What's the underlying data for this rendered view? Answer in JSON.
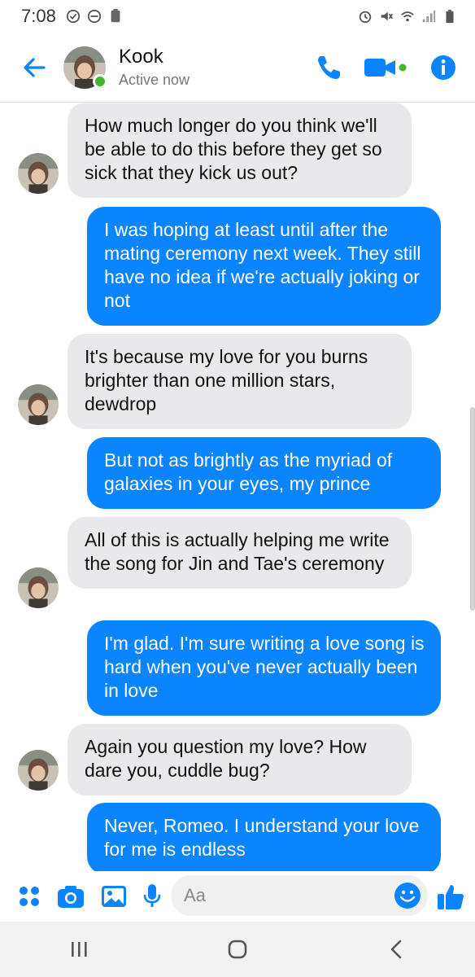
{
  "status_bar": {
    "time": "7:08",
    "left_icons": [
      "shield-check-icon",
      "do-not-disturb-icon",
      "battery-saver-icon"
    ],
    "right_icons": [
      "alarm-icon",
      "mute-icon",
      "wifi-icon",
      "signal-icon",
      "battery-icon"
    ]
  },
  "header": {
    "contact_name": "Kook",
    "contact_status": "Active now",
    "colors": {
      "accent": "#0b84ff",
      "active": "#42b72a"
    }
  },
  "messages": [
    {
      "direction": "in",
      "text": "How much longer do you think we'll be able to do this before they get so sick that they kick us out?"
    },
    {
      "direction": "out",
      "text": "I was hoping at least until after the mating ceremony next week. They still have no idea if we're actually joking or not"
    },
    {
      "direction": "in",
      "text": "It's because my love for you burns brighter than one million stars, dewdrop"
    },
    {
      "direction": "out",
      "text": "But not as brightly as the myriad of galaxies in your eyes, my prince"
    },
    {
      "direction": "in",
      "text": "All of this is actually helping me write the song for Jin and Tae's ceremony"
    },
    {
      "direction": "out",
      "text": "I'm glad. I'm sure writing a love song is hard when you've never actually been in love"
    },
    {
      "direction": "in",
      "text": "Again you question my love? How dare you, cuddle bug?"
    },
    {
      "direction": "out",
      "text": "Never, Romeo. I understand your love for me is endless"
    }
  ],
  "composer": {
    "placeholder": "Aa",
    "icons": [
      "apps-icon",
      "camera-icon",
      "gallery-icon",
      "microphone-icon",
      "emoji-icon",
      "thumbs-up-icon"
    ]
  },
  "navbar": {
    "icons": [
      "recent-apps-icon",
      "home-icon",
      "back-nav-icon"
    ]
  }
}
